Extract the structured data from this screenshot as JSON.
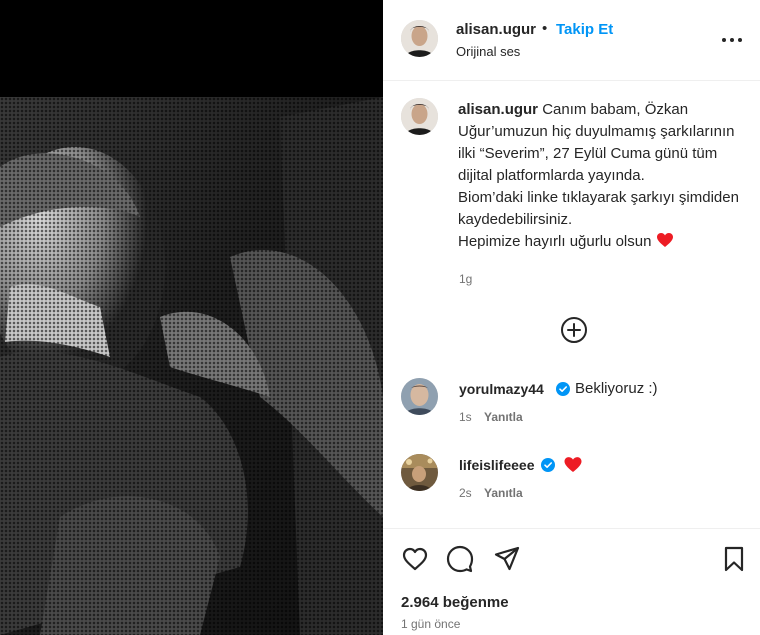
{
  "header": {
    "username": "alisan.ugur",
    "separator": "•",
    "follow_label": "Takip Et",
    "audio_label": "Orijinal ses",
    "more_icon": "more-horizontal-icon"
  },
  "caption": {
    "username": "alisan.ugur",
    "text": "Canım babam, Özkan Uğur’umuzun hiç duyulmamış şarkılarının ilki “Severim”, 27 Eylül Cuma günü tüm dijital platformlarda yayında.\nBiom’daki linke tıklayarak şarkıyı şimdiden kaydedebilirsiniz.\nHepimize hayırlı uğurlu olsun",
    "emoji": "❤️",
    "time": "1g"
  },
  "add_comment_icon": "plus-circle-icon",
  "comments": [
    {
      "username": "yorulmazy44",
      "verified": true,
      "text": "Bekliyoruz :)",
      "time": "1s",
      "reply_label": "Yanıtla"
    },
    {
      "username": "lifeislifeeee",
      "verified": true,
      "text": "❤️",
      "time": "2s",
      "reply_label": "Yanıtla"
    }
  ],
  "actions": {
    "like_icon": "heart-icon",
    "comment_icon": "comment-icon",
    "share_icon": "send-icon",
    "save_icon": "bookmark-icon",
    "likes_text": "2.964 beğenme",
    "date_text": "1 gün önce"
  },
  "colors": {
    "follow": "#0095f6",
    "verified": "#0095f6",
    "heart": "#ed1c24",
    "muted": "#737373",
    "media_bg": "#000000"
  }
}
